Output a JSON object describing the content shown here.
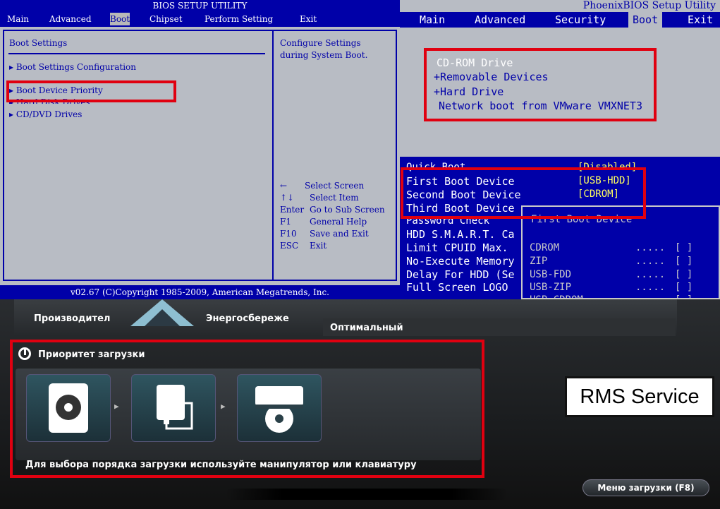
{
  "ami": {
    "title": "BIOS SETUP UTILITY",
    "menu": [
      "Main",
      "Advanced",
      "Boot",
      "Chipset",
      "Perform Setting",
      "Exit"
    ],
    "selected_menu": "Boot",
    "heading": "Boot Settings",
    "items": [
      "Boot Settings Configuration",
      "Boot Device Priority",
      "Hard Disk Drives",
      "CD/DVD Drives"
    ],
    "help_line1": "Configure Settings",
    "help_line2": "during System Boot.",
    "keys": [
      {
        "key": "←",
        "desc": "Select Screen"
      },
      {
        "key": "↑↓",
        "desc": "Select Item"
      },
      {
        "key": "Enter",
        "desc": "Go to Sub Screen"
      },
      {
        "key": "F1",
        "desc": "General Help"
      },
      {
        "key": "F10",
        "desc": "Save and Exit"
      },
      {
        "key": "ESC",
        "desc": "Exit"
      }
    ],
    "footer": "v02.67 (C)Copyright 1985-2009, American Megatrends, Inc."
  },
  "phoenix": {
    "title": "PhoenixBIOS Setup Utility",
    "menu": [
      "Main",
      "Advanced",
      "Security",
      "Boot",
      "Exit"
    ],
    "selected_menu": "Boot",
    "boot_order": [
      "CD-ROM Drive",
      "+Removable Devices",
      "+Hard Drive",
      "Network boot from VMware VMXNET3"
    ],
    "settings": [
      {
        "label": "Quick Boot",
        "value": "[Disabled]"
      },
      {
        "label": "First Boot Device",
        "value": "[USB-HDD]"
      },
      {
        "label": "Second Boot Device",
        "value": "[CDROM]"
      },
      {
        "label": "Third Boot Device",
        "value": ""
      },
      {
        "label": "Password Check",
        "value": ""
      },
      {
        "label": "HDD S.M.A.R.T. Ca",
        "value": ""
      },
      {
        "label": "Limit CPUID Max.",
        "value": ""
      },
      {
        "label": "No-Execute Memory",
        "value": ""
      },
      {
        "label": "Delay For HDD (Se",
        "value": ""
      },
      {
        "label": "Full Screen LOGO",
        "value": ""
      }
    ],
    "popup_title": "First Boot Device",
    "popup_items": [
      {
        "label": "CDROM",
        "dots": ".....",
        "box": "[ ]"
      },
      {
        "label": "ZIP",
        "dots": ".....",
        "box": "[ ]"
      },
      {
        "label": "USB-FDD",
        "dots": ".....",
        "box": "[ ]"
      },
      {
        "label": "USB-ZIP",
        "dots": ".....",
        "box": "[ ]"
      },
      {
        "label": "USB-CDROM",
        "dots": ".....",
        "box": "[ ]"
      }
    ]
  },
  "asus": {
    "tab1": "Производител",
    "tab2": "Энергосбереже",
    "tab3": "Оптимальный",
    "boot_priority_title": "Приоритет загрузки",
    "hint": "Для выбора порядка загрузки используйте манипулятор или клавиатуру",
    "boot_menu_button": "Меню загрузки (F8)",
    "devices": [
      "hard-disk",
      "usb-drive",
      "optical-drive"
    ]
  },
  "watermark": "RMS Service",
  "colors": {
    "highlight": "#e00010",
    "bios_blue": "#0000a8",
    "bios_gray": "#b8bcc4"
  }
}
